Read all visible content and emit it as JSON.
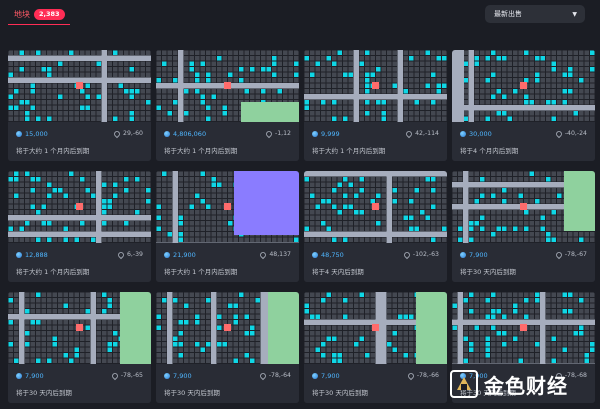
{
  "header": {
    "tab_label": "地块",
    "count": "2,383",
    "sort_label": "最新出售"
  },
  "colors": {
    "accent": "#ff2d55",
    "empty_parcel": "#444851",
    "parcel": "#0fd7e6",
    "road": "#a6adbd",
    "plaza": "#8fd19e",
    "district": "#8a7cff",
    "selected": "#ff6b6b"
  },
  "icons": {
    "price": "mana-icon",
    "location": "pin-icon",
    "sort": "chevron-down-icon"
  },
  "cards": [
    {
      "price": "15,000",
      "coords": "29,-60",
      "expires": "将于大约 1 个月内后到期"
    },
    {
      "price": "4,806,060",
      "coords": "-1,12",
      "expires": "将于大约 1 个月内后到期"
    },
    {
      "price": "9,999",
      "coords": "42,-114",
      "expires": "将于大约 1 个月内后到期"
    },
    {
      "price": "30,000",
      "coords": "-40,-24",
      "expires": "将于4 个月内后到期"
    },
    {
      "price": "12,888",
      "coords": "6,-39",
      "expires": "将于大约 1 个月内后到期"
    },
    {
      "price": "21,900",
      "coords": "48,137",
      "expires": "将于大约 1 个月内后到期"
    },
    {
      "price": "48,750",
      "coords": "-102,-63",
      "expires": "将于4 天内后到期"
    },
    {
      "price": "7,900",
      "coords": "-78,-67",
      "expires": "将于30 天内后到期"
    },
    {
      "price": "7,900",
      "coords": "-78,-65",
      "expires": "将于30 天内后到期"
    },
    {
      "price": "7,900",
      "coords": "-78,-64",
      "expires": "将于30 天内后到期"
    },
    {
      "price": "7,900",
      "coords": "-78,-66",
      "expires": "将于30 天内后到期"
    },
    {
      "price": "7,900",
      "coords": "-78,-68",
      "expires": "将于30 天内后到期"
    }
  ],
  "watermark": {
    "text": "金色财经"
  }
}
